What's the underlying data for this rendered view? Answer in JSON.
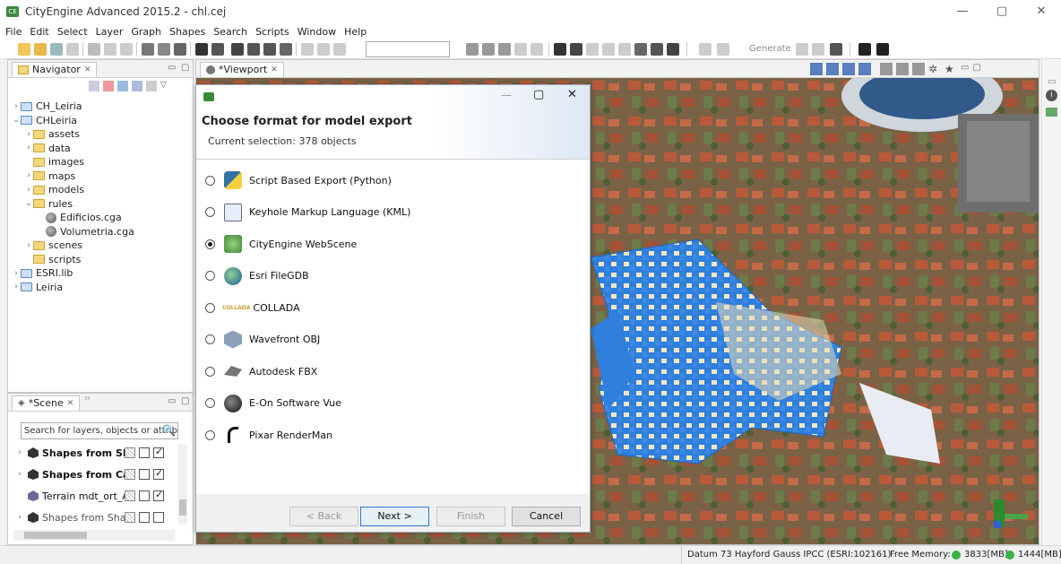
{
  "window": {
    "title": "CityEngine Advanced 2015.2 - chl.cej",
    "minimize": "—",
    "maximize": "▢",
    "close": "✕"
  },
  "menu": [
    "File",
    "Edit",
    "Select",
    "Layer",
    "Graph",
    "Shapes",
    "Search",
    "Scripts",
    "Window",
    "Help"
  ],
  "toolbar": {
    "generate_label": "Generate"
  },
  "navigator": {
    "tab_label": "Navigator",
    "tree": [
      {
        "label": "CH_Leiria",
        "type": "proj",
        "depth": 0,
        "chev": "›"
      },
      {
        "label": "CHLeiria",
        "type": "proj",
        "depth": 0,
        "chev": "⌄"
      },
      {
        "label": "assets",
        "type": "folder",
        "depth": 1,
        "chev": "›"
      },
      {
        "label": "data",
        "type": "folder",
        "depth": 1,
        "chev": "›"
      },
      {
        "label": "images",
        "type": "folder",
        "depth": 1,
        "chev": ""
      },
      {
        "label": "maps",
        "type": "folder",
        "depth": 1,
        "chev": "›"
      },
      {
        "label": "models",
        "type": "folder",
        "depth": 1,
        "chev": "›"
      },
      {
        "label": "rules",
        "type": "folder",
        "depth": 1,
        "chev": "⌄"
      },
      {
        "label": "Edificios.cga",
        "type": "cga",
        "depth": 2,
        "chev": ""
      },
      {
        "label": "Volumetria.cga",
        "type": "cga",
        "depth": 2,
        "chev": ""
      },
      {
        "label": "scenes",
        "type": "folder",
        "depth": 1,
        "chev": "›"
      },
      {
        "label": "scripts",
        "type": "folder",
        "depth": 1,
        "chev": ""
      },
      {
        "label": "ESRI.lib",
        "type": "proj",
        "depth": 0,
        "chev": "›"
      },
      {
        "label": "Leiria",
        "type": "proj",
        "depth": 0,
        "chev": "›"
      }
    ]
  },
  "scene": {
    "tab_label": "*Scene",
    "tab_extra": "²⁹",
    "search_placeholder": "Search for layers, objects or attrib",
    "layers": [
      {
        "label": "Shapes from SI_",
        "bold": true,
        "vis": false,
        "lock": false,
        "check": true
      },
      {
        "label": "Shapes from Car",
        "bold": true,
        "vis": false,
        "lock": false,
        "check": true
      },
      {
        "label": "Terrain mdt_ort_A",
        "bold": false,
        "vis": false,
        "lock": false,
        "check": true
      },
      {
        "label": "Shapes from Shap",
        "bold": false,
        "vis": false,
        "lock": false,
        "check": false
      }
    ]
  },
  "viewport": {
    "tab_label": "*Viewport"
  },
  "dialog": {
    "title": "Choose format for model export",
    "subtitle": "Current selection: 378 objects",
    "options": [
      {
        "label": "Script Based Export (Python)",
        "selected": false,
        "icon": "python-icon"
      },
      {
        "label": "Keyhole Markup Language (KML)",
        "selected": false,
        "icon": "kml-icon"
      },
      {
        "label": "CityEngine WebScene",
        "selected": true,
        "icon": "webscene-icon"
      },
      {
        "label": "Esri FileGDB",
        "selected": false,
        "icon": "globe-icon"
      },
      {
        "label": "COLLADA",
        "selected": false,
        "icon": "collada-icon",
        "icon_text": "COLLADA"
      },
      {
        "label": "Wavefront OBJ",
        "selected": false,
        "icon": "obj-icon"
      },
      {
        "label": "Autodesk FBX",
        "selected": false,
        "icon": "fbx-icon"
      },
      {
        "label": "E-On Software Vue",
        "selected": false,
        "icon": "vue-icon"
      },
      {
        "label": "Pixar RenderMan",
        "selected": false,
        "icon": "renderman-icon"
      }
    ],
    "buttons": {
      "back": "< Back",
      "next": "Next >",
      "finish": "Finish",
      "cancel": "Cancel"
    }
  },
  "status": {
    "datum": "Datum 73 Hayford Gauss IPCC (ESRI:102161)",
    "free_memory_label": "Free Memory:",
    "mem1": "3833[MB]",
    "mem2": "1444[MB]"
  }
}
